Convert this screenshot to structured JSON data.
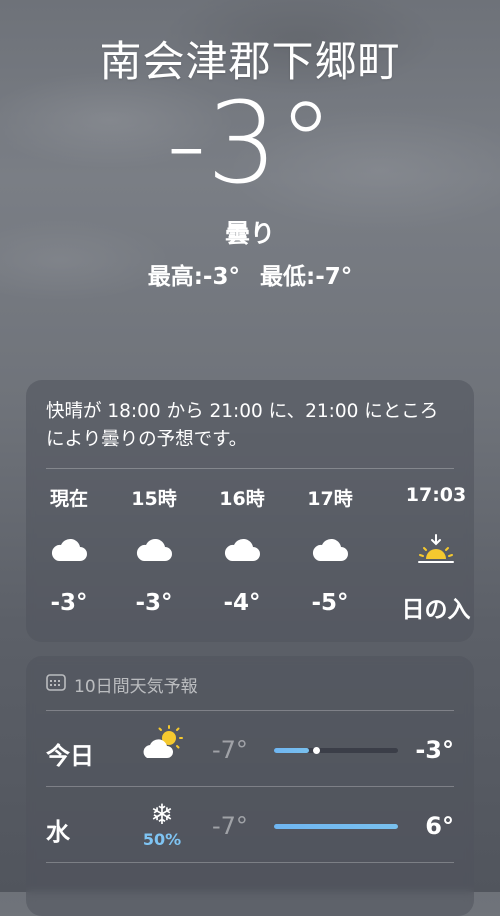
{
  "location": {
    "city": "南会津郡下郷町",
    "temperature": "-3°",
    "condition": "曇り"
  },
  "hilo": {
    "high": "最高:-3°",
    "low": "最低:-7°"
  },
  "hourly": {
    "summary": "快晴が 18:00 から 21:00 に、21:00 にところにより曇りの予想です。",
    "items": [
      {
        "label": "現在",
        "icon": "cloud-icon",
        "temp": "-3°"
      },
      {
        "label": "15時",
        "icon": "cloud-icon",
        "temp": "-3°"
      },
      {
        "label": "16時",
        "icon": "cloud-icon",
        "temp": "-4°"
      },
      {
        "label": "17時",
        "icon": "cloud-icon",
        "temp": "-5°"
      },
      {
        "label": "17:03",
        "icon": "sunset-icon",
        "temp": "日の入"
      }
    ]
  },
  "forecast": {
    "title": "10日間天気予報",
    "days": [
      {
        "day": "今日",
        "icon": "partly-cloudy-sun-icon",
        "precip": "",
        "low": "-7°",
        "high": "-3°",
        "range": {
          "start": 0.0,
          "end": 0.28,
          "current": 0.34
        }
      },
      {
        "day": "水",
        "icon": "snow-icon",
        "precip": "50%",
        "low": "-7°",
        "high": "6°",
        "range": {
          "start": 0.0,
          "end": 1.0
        }
      }
    ]
  },
  "colors": {
    "accent_blue": "#6fb6f2",
    "precip_blue": "#7fc4f3",
    "sun_yellow": "#f5c92f"
  }
}
